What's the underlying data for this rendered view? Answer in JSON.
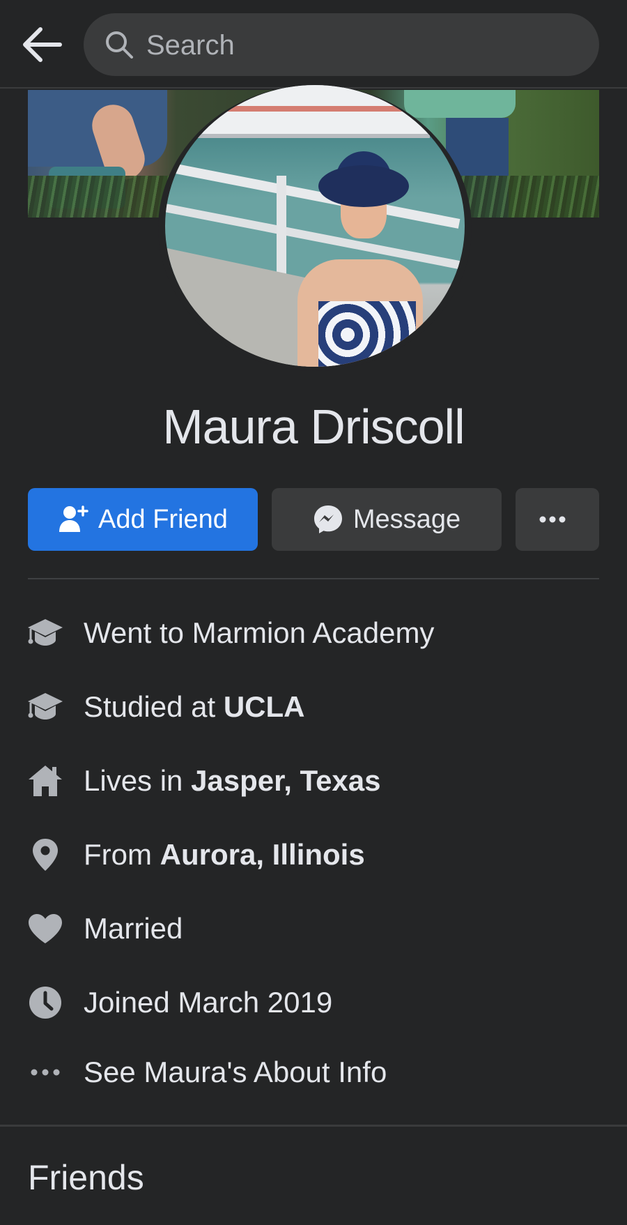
{
  "search": {
    "placeholder": "Search"
  },
  "profile": {
    "name": "Maura Driscoll"
  },
  "actions": {
    "add_friend": "Add Friend",
    "message": "Message",
    "more": "•••"
  },
  "info": [
    {
      "icon": "graduation-cap-icon",
      "prefix": "Went to Marmion Academy",
      "bold": ""
    },
    {
      "icon": "graduation-cap-icon",
      "prefix": "Studied at ",
      "bold": "UCLA"
    },
    {
      "icon": "home-icon",
      "prefix": "Lives in ",
      "bold": "Jasper, Texas"
    },
    {
      "icon": "location-pin-icon",
      "prefix": "From ",
      "bold": "Aurora, Illinois"
    },
    {
      "icon": "heart-icon",
      "prefix": "Married",
      "bold": ""
    },
    {
      "icon": "clock-icon",
      "prefix": "Joined March 2019",
      "bold": ""
    },
    {
      "icon": "more-dots-icon",
      "prefix": "See Maura's About Info",
      "bold": ""
    }
  ],
  "friends": {
    "title": "Friends"
  },
  "colors": {
    "background": "#242526",
    "surface": "#3a3b3c",
    "accent": "#2374e1",
    "text": "#e4e6eb",
    "icon": "#b0b3b8"
  }
}
